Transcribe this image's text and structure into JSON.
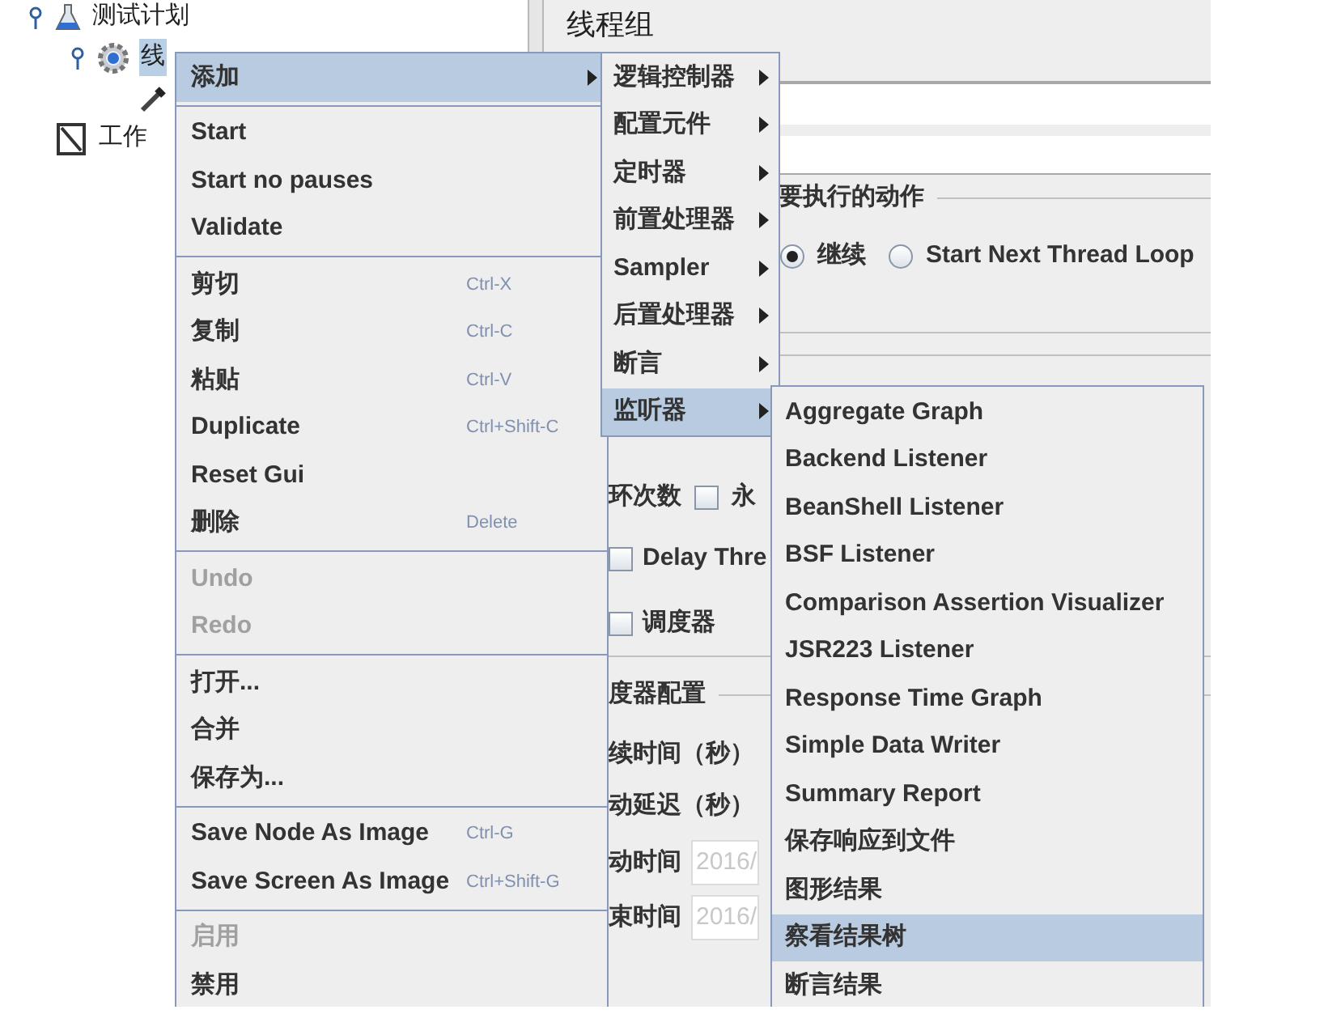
{
  "tree": [
    {
      "label": "测试计划",
      "kind": "flask",
      "selected": false,
      "children": [
        {
          "label": "线",
          "kind": "gear",
          "selected": true,
          "children": [
            {
              "kind": "pipette"
            }
          ]
        }
      ]
    },
    {
      "label": "工作",
      "kind": "notebook",
      "selected": false
    }
  ],
  "panel": {
    "title": "线程组",
    "action_label": "要执行的动作",
    "radios": [
      {
        "label": "继续",
        "selected": true
      },
      {
        "label": "Start Next Thread Loop",
        "selected": false
      }
    ],
    "loop_label": "环次数",
    "forever": {
      "label": "永",
      "checked": false
    },
    "delay": {
      "label": "Delay Thre",
      "checked": false
    },
    "scheduler": {
      "label": "调度器",
      "checked": false
    },
    "scheduler_config": "度器配置",
    "duration": "续时间（秒）",
    "startup_delay": "动延迟（秒）",
    "start_time": {
      "label": "动时间",
      "value": "2016/"
    },
    "end_time": {
      "label": "束时间",
      "value": "2016/"
    }
  },
  "context_menu": {
    "groups": [
      [
        {
          "label": "添加",
          "submenu": true,
          "selected": true
        }
      ],
      [
        {
          "label": "Start",
          "selected": false
        },
        {
          "label": "Start no pauses",
          "selected": false
        },
        {
          "label": "Validate",
          "selected": false
        }
      ],
      [
        {
          "label": "剪切",
          "shortcut": "Ctrl-X",
          "selected": false
        },
        {
          "label": "复制",
          "shortcut": "Ctrl-C",
          "selected": false
        },
        {
          "label": "粘贴",
          "shortcut": "Ctrl-V",
          "selected": false
        },
        {
          "label": "Duplicate",
          "shortcut": "Ctrl+Shift-C",
          "selected": false
        },
        {
          "label": "Reset Gui",
          "selected": false
        },
        {
          "label": "删除",
          "shortcut": "Delete",
          "selected": false
        }
      ],
      [
        {
          "label": "Undo",
          "disabled": true,
          "selected": false
        },
        {
          "label": "Redo",
          "disabled": true,
          "selected": false
        }
      ],
      [
        {
          "label": "打开...",
          "selected": false
        },
        {
          "label": "合并",
          "selected": false
        },
        {
          "label": "保存为...",
          "selected": false
        }
      ],
      [
        {
          "label": "Save Node As Image",
          "shortcut": "Ctrl-G",
          "selected": false
        },
        {
          "label": "Save Screen As Image",
          "shortcut": "Ctrl+Shift-G",
          "selected": false
        }
      ],
      [
        {
          "label": "启用",
          "disabled": true,
          "selected": false
        },
        {
          "label": "禁用",
          "selected": false
        }
      ]
    ]
  },
  "add_submenu": [
    {
      "label": "逻辑控制器",
      "selected": false
    },
    {
      "label": "配置元件",
      "selected": false
    },
    {
      "label": "定时器",
      "selected": false
    },
    {
      "label": "前置处理器",
      "selected": false
    },
    {
      "label": "Sampler",
      "selected": false
    },
    {
      "label": "后置处理器",
      "selected": false
    },
    {
      "label": "断言",
      "selected": false
    },
    {
      "label": "监听器",
      "selected": true
    }
  ],
  "listener_submenu": [
    {
      "label": "Aggregate Graph",
      "selected": false
    },
    {
      "label": "Backend Listener",
      "selected": false
    },
    {
      "label": "BeanShell Listener",
      "selected": false
    },
    {
      "label": "BSF Listener",
      "selected": false
    },
    {
      "label": "Comparison Assertion Visualizer",
      "selected": false
    },
    {
      "label": "JSR223 Listener",
      "selected": false
    },
    {
      "label": "Response Time Graph",
      "selected": false
    },
    {
      "label": "Simple Data Writer",
      "selected": false
    },
    {
      "label": "Summary Report",
      "selected": false
    },
    {
      "label": "保存响应到文件",
      "selected": false
    },
    {
      "label": "图形结果",
      "selected": false
    },
    {
      "label": "察看结果树",
      "selected": true
    },
    {
      "label": "断言结果",
      "selected": false
    }
  ]
}
